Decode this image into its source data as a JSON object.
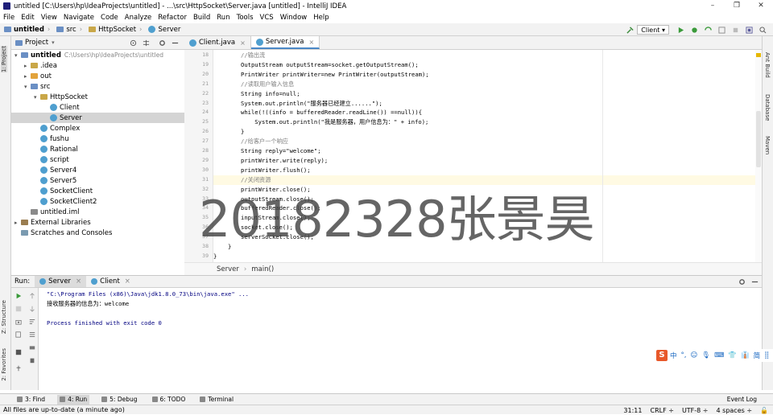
{
  "window": {
    "title": "untitled [C:\\Users\\hp\\IdeaProjects\\untitled] - ...\\src\\HttpSocket\\Server.java [untitled] - IntelliJ IDEA",
    "minimize": "–",
    "maximize": "❐",
    "close": "✕"
  },
  "menu": [
    "File",
    "Edit",
    "View",
    "Navigate",
    "Code",
    "Analyze",
    "Refactor",
    "Build",
    "Run",
    "Tools",
    "VCS",
    "Window",
    "Help"
  ],
  "breadcrumb": [
    "untitled",
    "src",
    "HttpSocket",
    "Server"
  ],
  "run_config": "Client",
  "project_panel": {
    "title": "Project",
    "tree": [
      {
        "label": "untitled",
        "extra": "C:\\Users\\hp\\IdeaProjects\\untitled",
        "indent": 0,
        "arrow": "▾",
        "icon": "folder-blue",
        "bold": true
      },
      {
        "label": ".idea",
        "indent": 1,
        "arrow": "▸",
        "icon": "folder"
      },
      {
        "label": "out",
        "indent": 1,
        "arrow": "▸",
        "icon": "folder-orange"
      },
      {
        "label": "src",
        "indent": 1,
        "arrow": "▾",
        "icon": "folder-blue"
      },
      {
        "label": "HttpSocket",
        "indent": 2,
        "arrow": "▾",
        "icon": "folder"
      },
      {
        "label": "Client",
        "indent": 3,
        "arrow": "",
        "icon": "class"
      },
      {
        "label": "Server",
        "indent": 3,
        "arrow": "",
        "icon": "class",
        "selected": true
      },
      {
        "label": "Complex",
        "indent": 2,
        "arrow": "",
        "icon": "class"
      },
      {
        "label": "fushu",
        "indent": 2,
        "arrow": "",
        "icon": "class"
      },
      {
        "label": "Rational",
        "indent": 2,
        "arrow": "",
        "icon": "class"
      },
      {
        "label": "script",
        "indent": 2,
        "arrow": "",
        "icon": "class"
      },
      {
        "label": "Server4",
        "indent": 2,
        "arrow": "",
        "icon": "class"
      },
      {
        "label": "Server5",
        "indent": 2,
        "arrow": "",
        "icon": "class"
      },
      {
        "label": "SocketClient",
        "indent": 2,
        "arrow": "",
        "icon": "class"
      },
      {
        "label": "SocketClient2",
        "indent": 2,
        "arrow": "",
        "icon": "class"
      },
      {
        "label": "untitled.iml",
        "indent": 1,
        "arrow": "",
        "icon": "file"
      },
      {
        "label": "External Libraries",
        "indent": 0,
        "arrow": "▸",
        "icon": "lib"
      },
      {
        "label": "Scratches and Consoles",
        "indent": 0,
        "arrow": "",
        "icon": "scratch"
      }
    ]
  },
  "editor_tabs": [
    {
      "label": "Client.java",
      "active": false
    },
    {
      "label": "Server.java",
      "active": true
    }
  ],
  "code_lines": [
    {
      "n": "18",
      "text": "//输出流",
      "type": "cmt"
    },
    {
      "n": "19",
      "text": "OutputStream outputStream=socket.getOutputStream();",
      "type": "plain"
    },
    {
      "n": "20",
      "text": "PrintWriter printWriter=new PrintWriter(outputStream);",
      "type": "plain"
    },
    {
      "n": "21",
      "text": "//读取用户输入信息",
      "type": "cmt"
    },
    {
      "n": "22",
      "text": "String info=null;",
      "type": "plain"
    },
    {
      "n": "23",
      "text": "System.out.println(\"服务器已经建立......\");",
      "type": "plain"
    },
    {
      "n": "24",
      "text": "while(!((info = bufferedReader.readLine()) ==null)){",
      "type": "plain"
    },
    {
      "n": "25",
      "text": "    System.out.println(\"我是服务器，用户信息为：\" + info);",
      "type": "plain"
    },
    {
      "n": "26",
      "text": "}",
      "type": "plain"
    },
    {
      "n": "27",
      "text": "//给客户一个响应",
      "type": "cmt"
    },
    {
      "n": "28",
      "text": "String reply=\"welcome\";",
      "type": "plain"
    },
    {
      "n": "29",
      "text": "printWriter.write(reply);",
      "type": "plain"
    },
    {
      "n": "30",
      "text": "printWriter.flush();",
      "type": "plain"
    },
    {
      "n": "31",
      "text": "//关闭资源",
      "type": "cmt",
      "highlight": true
    },
    {
      "n": "32",
      "text": "printWriter.close();",
      "type": "plain"
    },
    {
      "n": "33",
      "text": "outputStream.close();",
      "type": "plain"
    },
    {
      "n": "34",
      "text": "bufferedReader.close();",
      "type": "plain"
    },
    {
      "n": "35",
      "text": "inputStream.close();",
      "type": "plain"
    },
    {
      "n": "36",
      "text": "socket.close();",
      "type": "plain"
    },
    {
      "n": "37",
      "text": "serverSocket.close();",
      "type": "plain"
    },
    {
      "n": "38",
      "text": "}",
      "type": "plain",
      "outdent": true
    },
    {
      "n": "39",
      "text": "}",
      "type": "plain",
      "outdent2": true
    }
  ],
  "editor_breadcrumb": [
    "Server",
    "main()"
  ],
  "run_panel": {
    "label": "Run:",
    "tabs": [
      {
        "label": "Server",
        "active": true
      },
      {
        "label": "Client",
        "active": false
      }
    ],
    "console": [
      {
        "text": "\"C:\\Program Files (x86)\\Java\\jdk1.8.0_73\\bin\\java.exe\" ...",
        "color": "#000080"
      },
      {
        "text": "接收服务器的信息为：welcome",
        "color": "#000000"
      },
      {
        "text": "",
        "color": "#000000"
      },
      {
        "text": "Process finished with exit code 0",
        "color": "#000080"
      }
    ]
  },
  "left_strip": [
    "1: Project",
    "Z: Structure",
    "2: Favorites"
  ],
  "right_strip": [
    "Ant Build",
    "Database",
    "Maven"
  ],
  "bottom_tabs": [
    {
      "label": "3: Find",
      "active": false
    },
    {
      "label": "4: Run",
      "active": true
    },
    {
      "label": "5: Debug",
      "active": false
    },
    {
      "label": "6: TODO",
      "active": false
    },
    {
      "label": "Terminal",
      "active": false
    }
  ],
  "event_log": "Event Log",
  "status": {
    "message": "All files are up-to-date (a minute ago)",
    "position": "31:11",
    "line_sep": "CRLF ÷",
    "encoding": "UTF-8 ÷",
    "indent": "4 spaces ÷"
  },
  "watermark": "20182328张景昊",
  "ime": {
    "logo": "S",
    "items": [
      "中",
      "°,",
      "☺",
      "🎙",
      "⌨",
      "👕",
      "👔",
      "简",
      "⣿"
    ]
  },
  "colors": {
    "accent": "#4a88c7",
    "selection": "#d4d4d4",
    "caret_row": "#fffae3"
  }
}
